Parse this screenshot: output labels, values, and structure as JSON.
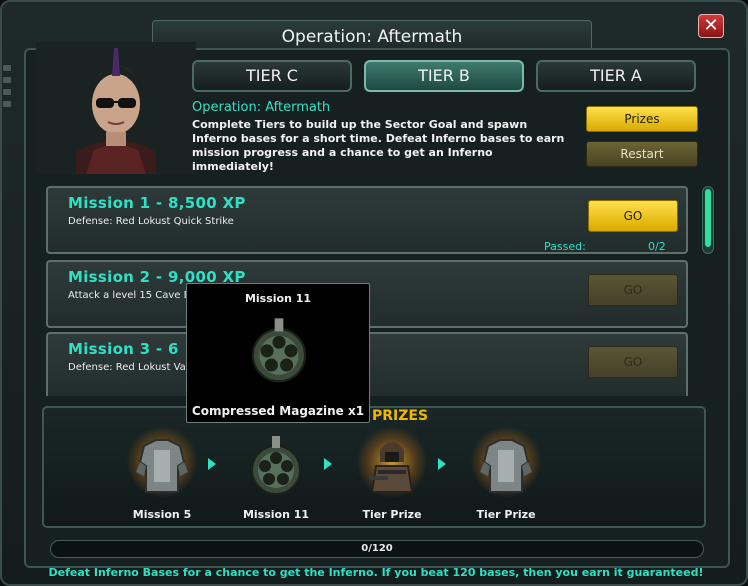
{
  "header": {
    "title": "Operation: Aftermath",
    "close_label": "✕"
  },
  "tabs": [
    {
      "label": "TIER C",
      "active": false
    },
    {
      "label": "TIER B",
      "active": true
    },
    {
      "label": "TIER A",
      "active": false
    }
  ],
  "operation": {
    "title": "Operation: Aftermath",
    "description": "Complete Tiers to build up the Sector Goal and spawn Inferno bases for a short time. Defeat Inferno bases to earn mission progress and a chance to get an Inferno immediately!"
  },
  "buttons": {
    "prizes": "Prizes",
    "restart": "Restart"
  },
  "missions": [
    {
      "title": "Mission 1 - 8,500 XP",
      "subtitle": "Defense: Red Lokust Quick Strike",
      "go": "GO",
      "enabled": true,
      "passed_label": "Passed:",
      "passed_value": "0/2"
    },
    {
      "title": "Mission 2 - 9,000 XP",
      "subtitle": "Attack a level 15 Cave B",
      "go": "GO",
      "enabled": false
    },
    {
      "title": "Mission 3 - 6",
      "subtitle": "Defense: Red Lokust Va",
      "go": "GO",
      "enabled": false
    }
  ],
  "prizes": {
    "label": "PRIZES",
    "items": [
      {
        "label": "Mission 5",
        "icon": "armor-icon"
      },
      {
        "label": "Mission 11",
        "icon": "magazine-icon"
      },
      {
        "label": "Tier Prize",
        "icon": "soldier-icon"
      },
      {
        "label": "Tier Prize",
        "icon": "armor-icon"
      }
    ]
  },
  "progress": {
    "text": "0/120",
    "fraction": 0.0
  },
  "footer": "Defeat Inferno Bases for a chance to get the Inferno. If you beat 120 bases, then you earn it guaranteed!",
  "tooltip": {
    "title": "Mission 11",
    "label": "Compressed Magazine x1"
  },
  "colors": {
    "accent": "#2ee0c4",
    "button_yellow": "#ffd21f",
    "prize_gold": "#f0b800"
  }
}
